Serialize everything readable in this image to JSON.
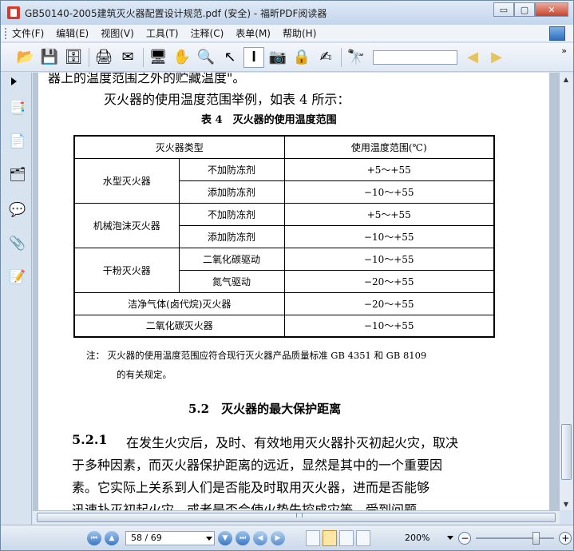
{
  "window": {
    "title": "GB50140-2005建筑灭火器配置设计规范.pdf (安全) - 福昕PDF阅读器",
    "buttons": {
      "minimize": "▭",
      "maximize": "▢",
      "close": "✕"
    }
  },
  "menu": [
    "文件(F)",
    "编辑(E)",
    "视图(V)",
    "工具(T)",
    "注释(C)",
    "表单(M)",
    "帮助(H)"
  ],
  "toolbar": {
    "icons": [
      "open-folder-icon",
      "save-icon",
      "save-all-icon",
      "print-icon",
      "email-icon",
      "fullscreen-icon",
      "hand-tool-icon",
      "zoom-tool-icon",
      "select-arrow-icon",
      "text-select-icon",
      "snapshot-icon",
      "rms-icon",
      "sign-icon",
      "find-binoculars-icon",
      "find-prev-icon",
      "find-next-icon"
    ],
    "find_value": "",
    "more": "»"
  },
  "document": {
    "line_top_partial": "器上的温度范围之外的贮藏温度\"。",
    "intro": "灭火器的使用温度范围举例，如表 4 所示：",
    "table_title": "表 4　灭火器的使用温度范围",
    "table": {
      "headers": [
        "灭火器类型",
        "使用温度范围(℃)"
      ],
      "rows": [
        {
          "type": "水型灭火器",
          "sub": "不加防冻剂",
          "range": "+5～+55"
        },
        {
          "type": "",
          "sub": "添加防冻剂",
          "range": "−10～+55"
        },
        {
          "type": "机械泡沫灭火器",
          "sub": "不加防冻剂",
          "range": "+5～+55"
        },
        {
          "type": "",
          "sub": "添加防冻剂",
          "range": "−10～+55"
        },
        {
          "type": "干粉灭火器",
          "sub": "二氧化碳驱动",
          "range": "−10～+55"
        },
        {
          "type": "",
          "sub": "氮气驱动",
          "range": "−20～+55"
        },
        {
          "type": "洁净气体(卤代烷)灭火器",
          "sub": "",
          "range": "−20～+55"
        },
        {
          "type": "二氧化碳灭火器",
          "sub": "",
          "range": "−10～+55"
        }
      ]
    },
    "note_line1": "注：  灭火器的使用温度范围应符合现行灭火器产品质量标准 GB 4351 和 GB 8109",
    "note_line2": "的有关规定。",
    "section_heading": "5.2　灭火器的最大保护距离",
    "para_num": "5.2.1",
    "para_line1": "在发生火灾后，及时、有效地用灭火器扑灭初起火灾，取决",
    "para_line2": "于多种因素，而灭火器保护距离的远近，显然是其中的一个重要因",
    "para_line3": "素。它实际上关系到人们是否能及时取用灭火器，进而是否能够",
    "para_line4_partial": "迅速扑灭初起火灾，或者是否会使火势失控成灾等。受到问题"
  },
  "status": {
    "page_input": "58 / 69",
    "zoom": "200%"
  }
}
